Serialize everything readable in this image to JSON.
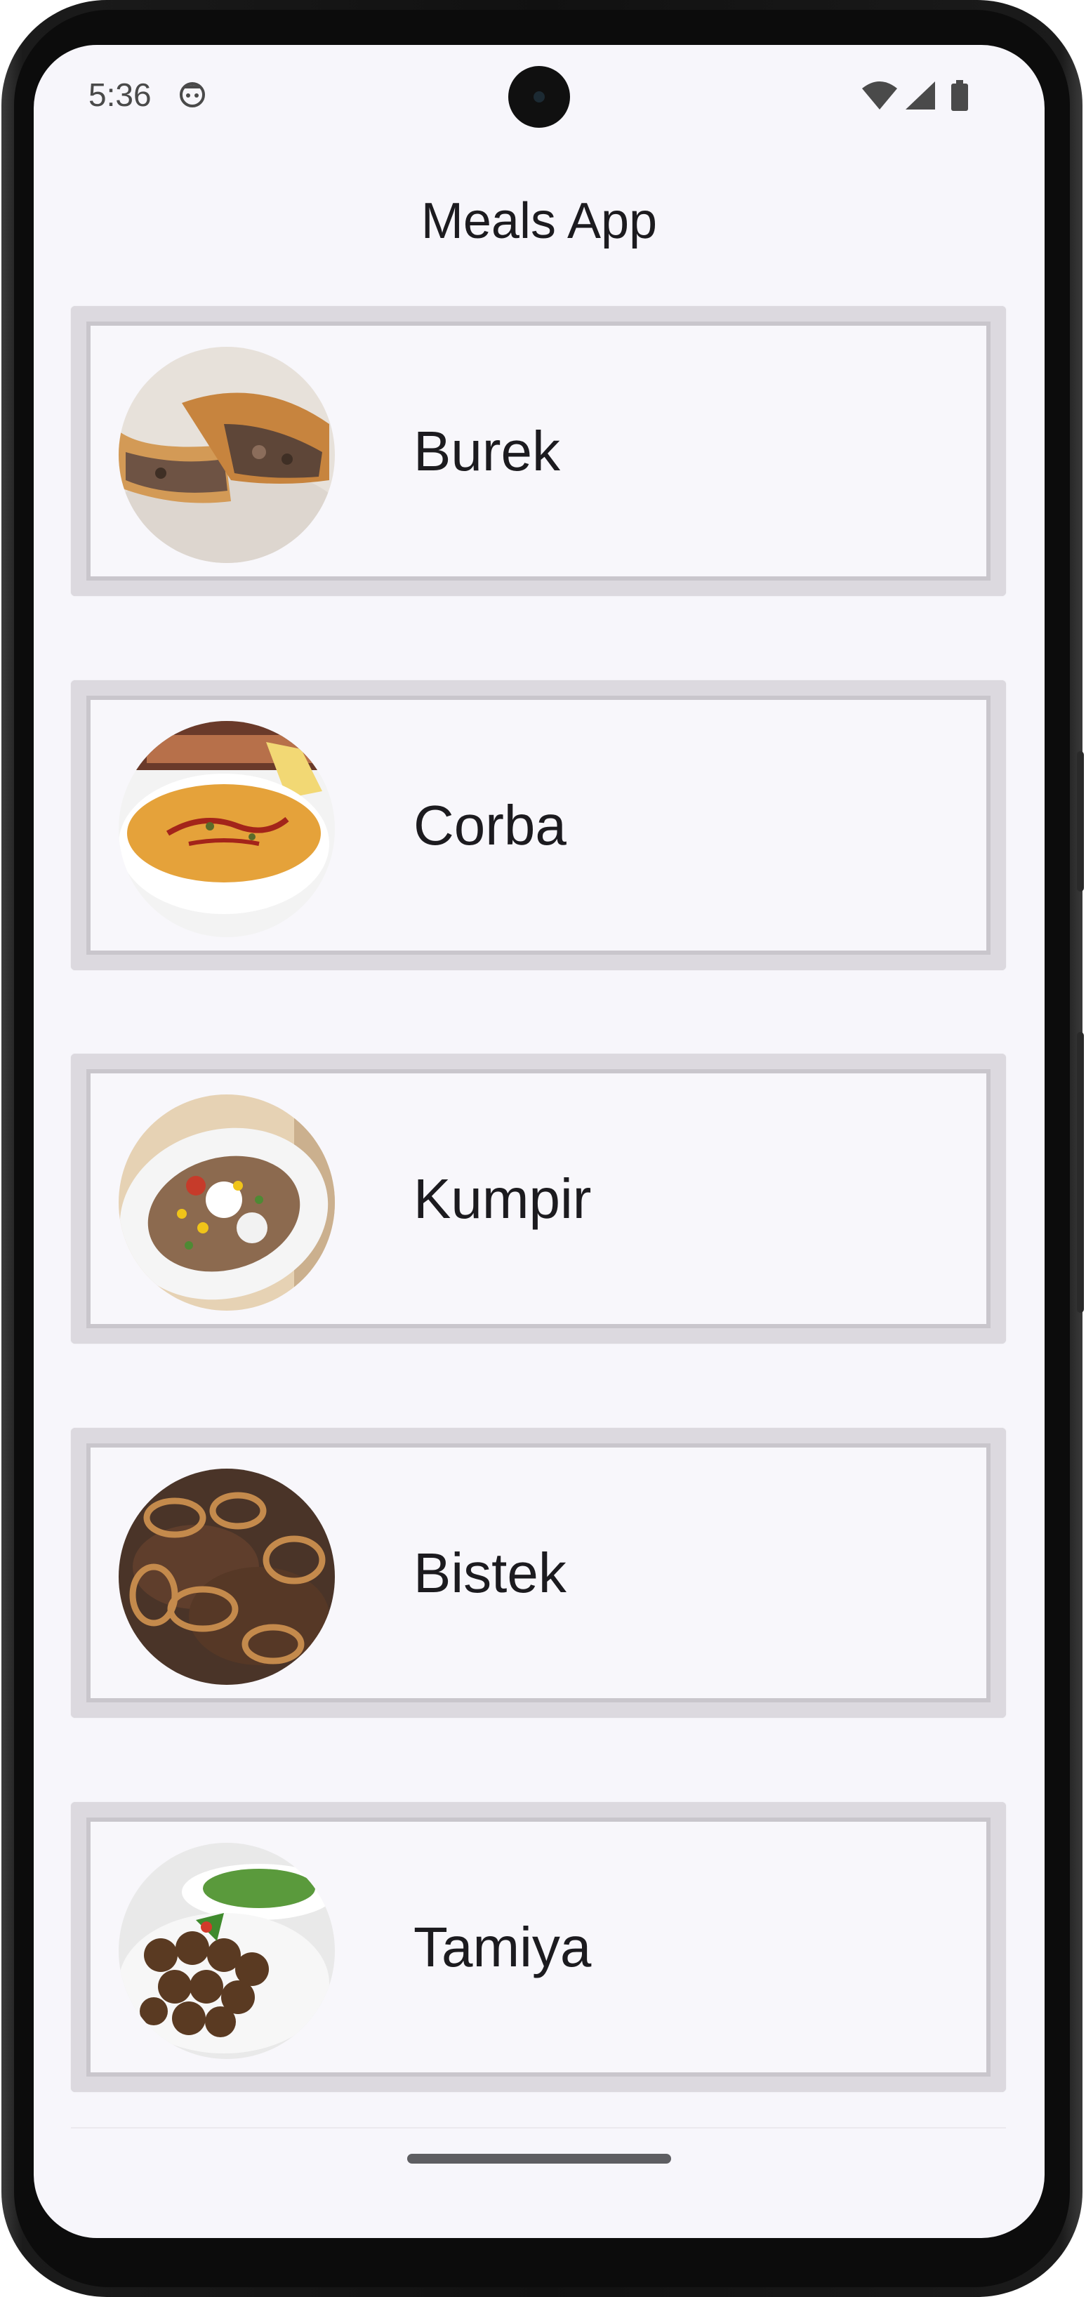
{
  "status_bar": {
    "time": "5:36",
    "icons": [
      "android-face-icon",
      "wifi-icon",
      "signal-icon",
      "battery-icon"
    ]
  },
  "app_bar": {
    "title": "Meals App"
  },
  "meals": [
    {
      "name": "Burek",
      "image": "burek-photo"
    },
    {
      "name": "Corba",
      "image": "corba-photo"
    },
    {
      "name": "Kumpir",
      "image": "kumpir-photo"
    },
    {
      "name": "Bistek",
      "image": "bistek-photo"
    },
    {
      "name": "Tamiya",
      "image": "tamiya-photo"
    }
  ],
  "colors": {
    "screen_background": "#f7f6fb",
    "card_border": "#c9c6cc",
    "text": "#1c1b1f"
  }
}
